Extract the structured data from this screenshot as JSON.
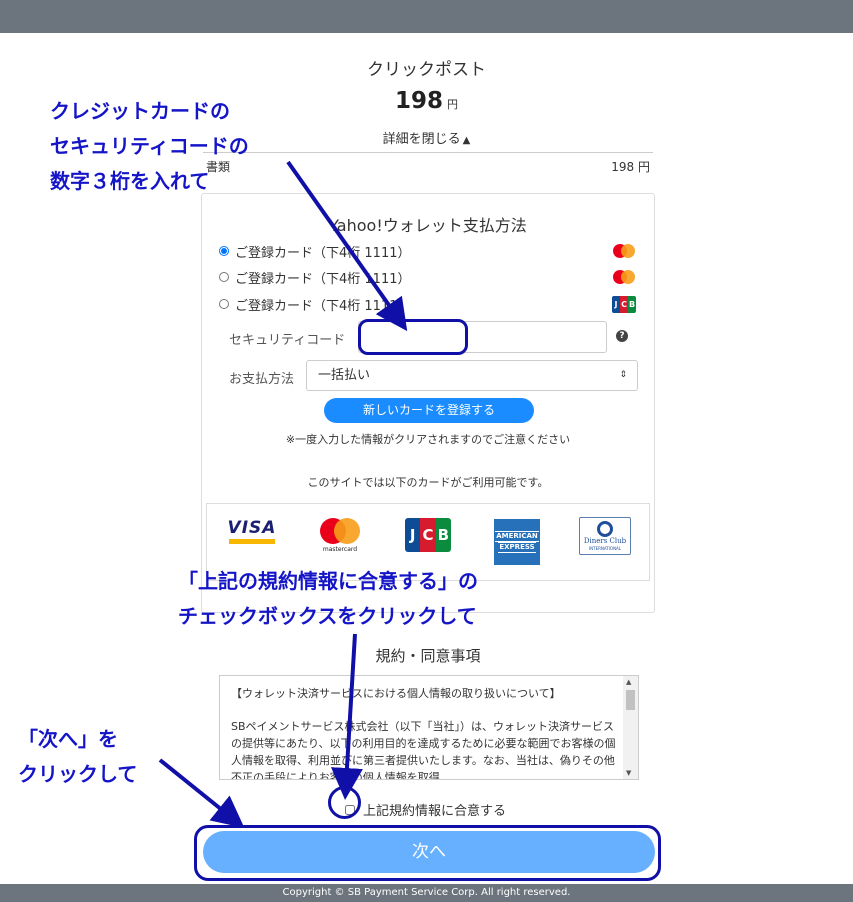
{
  "summary": {
    "service_name": "クリックポスト",
    "price": "198",
    "price_unit": "円",
    "toggle_details": "詳細を閉じる",
    "item_label": "書類",
    "item_price": "198 円"
  },
  "wallet": {
    "title": "Yahoo!ウォレット支払方法",
    "cards": [
      {
        "label": "ご登録カード（下4桁 1111）",
        "brand": "mastercard-icon",
        "selected": true
      },
      {
        "label": "ご登録カード（下4桁 1111）",
        "brand": "mastercard-icon",
        "selected": false
      },
      {
        "label": "ご登録カード（下4桁 1111）",
        "brand": "jcb-icon",
        "selected": false
      }
    ],
    "security_code_label": "セキュリティコード",
    "security_code_value": "",
    "help_glyph": "?",
    "payment_method_label": "お支払方法",
    "payment_method_value": "一括払い",
    "select_arrows": "⇕",
    "new_card_button": "新しいカードを登録する",
    "notice": "※一度入力した情報がクリアされますのでご注意ください",
    "available_cards_text": "このサイトでは以下のカードがご利用可能です。"
  },
  "brand_logos": {
    "visa": "VISA",
    "mastercard": "mastercard",
    "jcb": [
      "J",
      "C",
      "B"
    ],
    "amex": [
      "AMERICAN",
      "EXPRESS"
    ],
    "diners": [
      "Diners Club",
      "INTERNATIONAL"
    ]
  },
  "brand_colors": {
    "jcb": [
      "#0e4c96",
      "#d71b2e",
      "#0b8b3e"
    ],
    "visa": "#1a1f71",
    "amex": "#2671b9"
  },
  "terms": {
    "title": "規約・同意事項",
    "heading": "【ウォレット決済サービスにおける個人情報の取り扱いについて】",
    "body": "SBペイメントサービス株式会社（以下「当社」）は、ウォレット決済サービスの提供等にあたり、以下の利用目的を達成するために必要な範囲でお客様の個人情報を取得、利用並びに第三者提供いたします。なお、当社は、偽りその他不正の手段によりお客様の個人情報を取得",
    "agree_label": "上記規約情報に合意する"
  },
  "next_button": "次へ",
  "footer": "Copyright © SB Payment Service Corp. All right reserved.",
  "annotations": {
    "note1": [
      "クレジットカードの",
      "セキュリティコードの",
      "数字３桁を入れて"
    ],
    "note2": [
      "「上記の規約情報に合意する」の",
      "チェックボックスをクリックして"
    ],
    "note3": [
      "「次へ」を",
      "クリックして"
    ],
    "color": "#1515c8"
  }
}
